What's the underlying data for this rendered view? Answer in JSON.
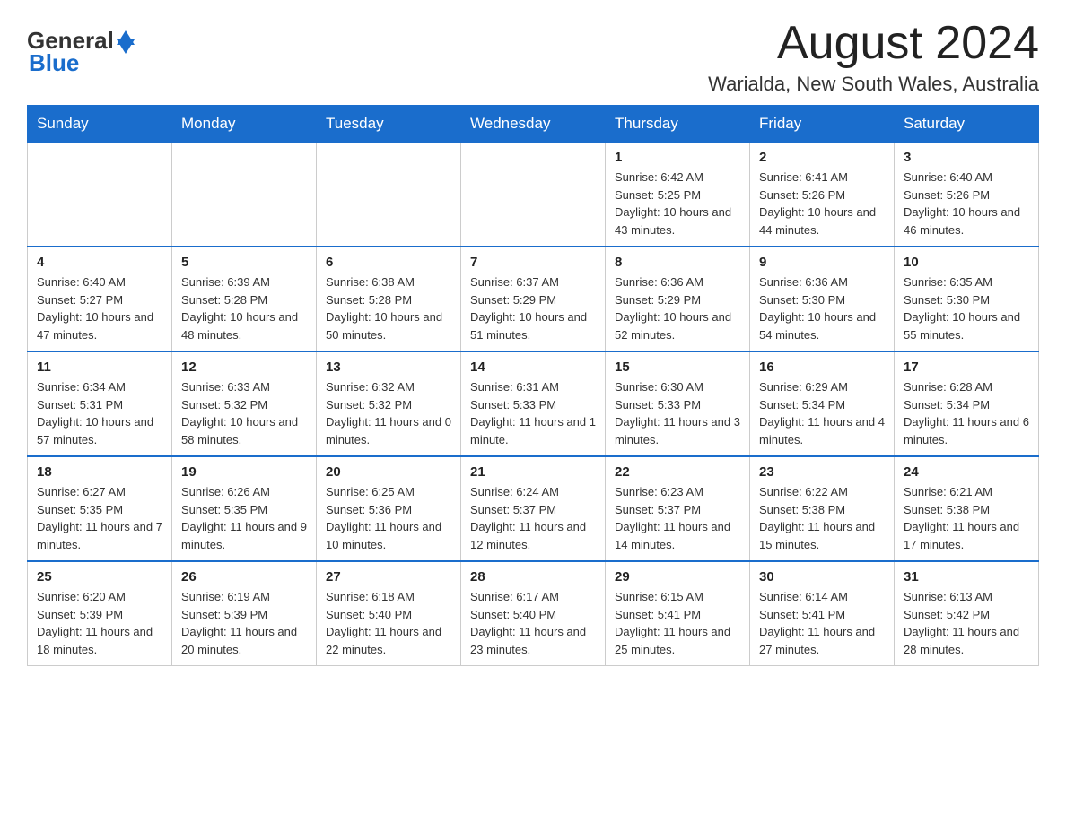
{
  "logo": {
    "general": "General",
    "blue": "Blue"
  },
  "header": {
    "month": "August 2024",
    "location": "Warialda, New South Wales, Australia"
  },
  "days_of_week": [
    "Sunday",
    "Monday",
    "Tuesday",
    "Wednesday",
    "Thursday",
    "Friday",
    "Saturday"
  ],
  "weeks": [
    [
      {
        "day": "",
        "info": ""
      },
      {
        "day": "",
        "info": ""
      },
      {
        "day": "",
        "info": ""
      },
      {
        "day": "",
        "info": ""
      },
      {
        "day": "1",
        "info": "Sunrise: 6:42 AM\nSunset: 5:25 PM\nDaylight: 10 hours and 43 minutes."
      },
      {
        "day": "2",
        "info": "Sunrise: 6:41 AM\nSunset: 5:26 PM\nDaylight: 10 hours and 44 minutes."
      },
      {
        "day": "3",
        "info": "Sunrise: 6:40 AM\nSunset: 5:26 PM\nDaylight: 10 hours and 46 minutes."
      }
    ],
    [
      {
        "day": "4",
        "info": "Sunrise: 6:40 AM\nSunset: 5:27 PM\nDaylight: 10 hours and 47 minutes."
      },
      {
        "day": "5",
        "info": "Sunrise: 6:39 AM\nSunset: 5:28 PM\nDaylight: 10 hours and 48 minutes."
      },
      {
        "day": "6",
        "info": "Sunrise: 6:38 AM\nSunset: 5:28 PM\nDaylight: 10 hours and 50 minutes."
      },
      {
        "day": "7",
        "info": "Sunrise: 6:37 AM\nSunset: 5:29 PM\nDaylight: 10 hours and 51 minutes."
      },
      {
        "day": "8",
        "info": "Sunrise: 6:36 AM\nSunset: 5:29 PM\nDaylight: 10 hours and 52 minutes."
      },
      {
        "day": "9",
        "info": "Sunrise: 6:36 AM\nSunset: 5:30 PM\nDaylight: 10 hours and 54 minutes."
      },
      {
        "day": "10",
        "info": "Sunrise: 6:35 AM\nSunset: 5:30 PM\nDaylight: 10 hours and 55 minutes."
      }
    ],
    [
      {
        "day": "11",
        "info": "Sunrise: 6:34 AM\nSunset: 5:31 PM\nDaylight: 10 hours and 57 minutes."
      },
      {
        "day": "12",
        "info": "Sunrise: 6:33 AM\nSunset: 5:32 PM\nDaylight: 10 hours and 58 minutes."
      },
      {
        "day": "13",
        "info": "Sunrise: 6:32 AM\nSunset: 5:32 PM\nDaylight: 11 hours and 0 minutes."
      },
      {
        "day": "14",
        "info": "Sunrise: 6:31 AM\nSunset: 5:33 PM\nDaylight: 11 hours and 1 minute."
      },
      {
        "day": "15",
        "info": "Sunrise: 6:30 AM\nSunset: 5:33 PM\nDaylight: 11 hours and 3 minutes."
      },
      {
        "day": "16",
        "info": "Sunrise: 6:29 AM\nSunset: 5:34 PM\nDaylight: 11 hours and 4 minutes."
      },
      {
        "day": "17",
        "info": "Sunrise: 6:28 AM\nSunset: 5:34 PM\nDaylight: 11 hours and 6 minutes."
      }
    ],
    [
      {
        "day": "18",
        "info": "Sunrise: 6:27 AM\nSunset: 5:35 PM\nDaylight: 11 hours and 7 minutes."
      },
      {
        "day": "19",
        "info": "Sunrise: 6:26 AM\nSunset: 5:35 PM\nDaylight: 11 hours and 9 minutes."
      },
      {
        "day": "20",
        "info": "Sunrise: 6:25 AM\nSunset: 5:36 PM\nDaylight: 11 hours and 10 minutes."
      },
      {
        "day": "21",
        "info": "Sunrise: 6:24 AM\nSunset: 5:37 PM\nDaylight: 11 hours and 12 minutes."
      },
      {
        "day": "22",
        "info": "Sunrise: 6:23 AM\nSunset: 5:37 PM\nDaylight: 11 hours and 14 minutes."
      },
      {
        "day": "23",
        "info": "Sunrise: 6:22 AM\nSunset: 5:38 PM\nDaylight: 11 hours and 15 minutes."
      },
      {
        "day": "24",
        "info": "Sunrise: 6:21 AM\nSunset: 5:38 PM\nDaylight: 11 hours and 17 minutes."
      }
    ],
    [
      {
        "day": "25",
        "info": "Sunrise: 6:20 AM\nSunset: 5:39 PM\nDaylight: 11 hours and 18 minutes."
      },
      {
        "day": "26",
        "info": "Sunrise: 6:19 AM\nSunset: 5:39 PM\nDaylight: 11 hours and 20 minutes."
      },
      {
        "day": "27",
        "info": "Sunrise: 6:18 AM\nSunset: 5:40 PM\nDaylight: 11 hours and 22 minutes."
      },
      {
        "day": "28",
        "info": "Sunrise: 6:17 AM\nSunset: 5:40 PM\nDaylight: 11 hours and 23 minutes."
      },
      {
        "day": "29",
        "info": "Sunrise: 6:15 AM\nSunset: 5:41 PM\nDaylight: 11 hours and 25 minutes."
      },
      {
        "day": "30",
        "info": "Sunrise: 6:14 AM\nSunset: 5:41 PM\nDaylight: 11 hours and 27 minutes."
      },
      {
        "day": "31",
        "info": "Sunrise: 6:13 AM\nSunset: 5:42 PM\nDaylight: 11 hours and 28 minutes."
      }
    ]
  ]
}
